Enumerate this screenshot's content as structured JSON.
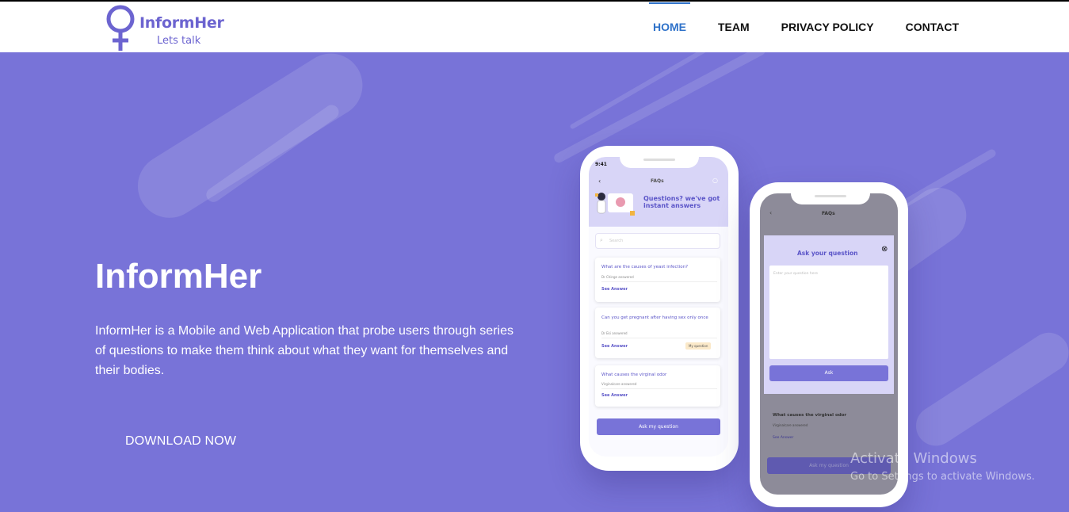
{
  "logo": {
    "name": "InformHer",
    "tagline": "Lets talk"
  },
  "nav": {
    "items": [
      {
        "label": "HOME",
        "active": true
      },
      {
        "label": "TEAM",
        "active": false
      },
      {
        "label": "PRIVACY POLICY",
        "active": false
      },
      {
        "label": "CONTACT",
        "active": false
      }
    ]
  },
  "hero": {
    "title": "InformHer",
    "description": "InformHer is a Mobile and Web Application that probe users through series of questions to make them think about what they want for themselves and their bodies.",
    "download_label": "DOWNLOAD NOW"
  },
  "phone1": {
    "time": "9:41",
    "screen_title": "FAQs",
    "banner": "Questions? we've got instant answers",
    "search_placeholder": "Search",
    "faqs": [
      {
        "question": "What are the causes of yeast infection?",
        "answered_by": "Dr Chinge answered",
        "link": "See Answer",
        "badge": ""
      },
      {
        "question": "Can you get pregnant after having sex only once",
        "answered_by": "Dr Eki answered",
        "link": "See Answer",
        "badge": "My question"
      },
      {
        "question": "What causes the virginal odor",
        "answered_by": "Virginalcare answered",
        "link": "See Answer",
        "badge": ""
      }
    ],
    "ask_button": "Ask my question"
  },
  "phone2": {
    "screen_title": "FAQs",
    "modal_title": "Ask your question",
    "textarea_placeholder": "Enter your question here",
    "modal_button": "Ask",
    "bg_question": "What causes the virginal odor",
    "bg_answered": "Virginalcare answered",
    "bg_link": "See Answer",
    "bg_button": "Ask my question"
  },
  "windows_watermark": {
    "title": "Activate Windows",
    "subtitle": "Go to Settings to activate Windows."
  },
  "colors": {
    "brand": "#7873d8",
    "nav_active": "#2f72c9"
  }
}
